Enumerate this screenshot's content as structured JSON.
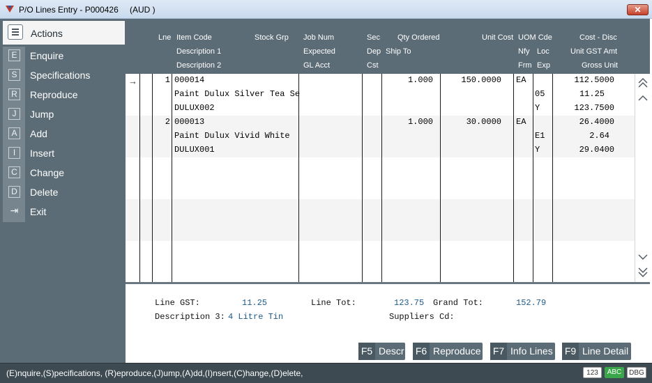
{
  "window": {
    "title": "P/O Lines Entry - P000426",
    "currency": "(AUD  )",
    "close_label": "✕"
  },
  "sidebar": {
    "header": "Actions",
    "items": [
      {
        "key": "E",
        "label": "Enquire"
      },
      {
        "key": "S",
        "label": "Specifications"
      },
      {
        "key": "R",
        "label": "Reproduce"
      },
      {
        "key": "J",
        "label": "Jump"
      },
      {
        "key": "A",
        "label": "Add"
      },
      {
        "key": "I",
        "label": "Insert"
      },
      {
        "key": "C",
        "label": "Change"
      },
      {
        "key": "D",
        "label": "Delete"
      },
      {
        "key": "⇥",
        "label": "Exit"
      }
    ]
  },
  "grid": {
    "headers": {
      "line": "Lne",
      "item_code": "Item Code",
      "description1": "Description 1",
      "description2": "Description 2",
      "stock_grp": "Stock Grp",
      "job_num": "Job Num",
      "expected": "Expected",
      "gl_acct": "GL Acct",
      "sec": "Sec",
      "dep": "Dep",
      "cst": "Cst",
      "qty_ordered": "Qty Ordered",
      "ship_to": "Ship To",
      "unit_cost": "Unit Cost",
      "uom_cde": "UOM Cde",
      "nfy": "Nfy",
      "loc": "Loc",
      "frm": "Frm",
      "exp": "Exp",
      "cost_disc": "Cost - Disc",
      "unit_gst_amt": "Unit GST Amt",
      "gross_unit": "Gross Unit"
    },
    "row_pointer": "→",
    "rows": [
      {
        "line": "1",
        "item_code": "000014",
        "description1": "Paint Dulux Silver Tea Se",
        "description2": "DULUX002",
        "qty_ordered": "1.000",
        "unit_cost": "150.0000",
        "uom": "EA",
        "loc": "05",
        "exp": "Y",
        "cost_disc": "112.5000",
        "unit_gst_amt": "11.25",
        "gross_unit": "123.7500"
      },
      {
        "line": "2",
        "item_code": "000013",
        "description1": "Paint Dulux Vivid White",
        "description2": "DULUX001",
        "qty_ordered": "1.000",
        "unit_cost": "30.0000",
        "uom": "EA",
        "loc": "E1",
        "exp": "Y",
        "cost_disc": "26.4000",
        "unit_gst_amt": "2.64",
        "gross_unit": "29.0400"
      }
    ]
  },
  "footer": {
    "line_gst_label": "Line GST:",
    "line_gst_value": "11.25",
    "line_tot_label": "Line Tot:",
    "line_tot_value": "123.75",
    "grand_tot_label": "Grand Tot:",
    "grand_tot_value": "152.79",
    "description3_label": "Description 3:",
    "description3_value": "4 Litre Tin",
    "suppliers_cd_label": "Suppliers Cd:",
    "suppliers_cd_value": ""
  },
  "function_keys": [
    {
      "key": "F5",
      "label": "Descr"
    },
    {
      "key": "F6",
      "label": "Reproduce"
    },
    {
      "key": "F7",
      "label": "Info Lines"
    },
    {
      "key": "F9",
      "label": "Line Detail"
    }
  ],
  "status": {
    "text": "(E)nquire,(S)pecifications, (R)eproduce,(J)ump,(A)dd,(I)nsert,(C)hange,(D)elete,",
    "badges": [
      "123",
      "ABC",
      "DBG"
    ]
  },
  "colors": {
    "sidebar_bg": "#5c6c76",
    "status_bg": "#3d4a52",
    "abc_badge": "#3aa64a",
    "value_blue": "#1d5a8a"
  }
}
